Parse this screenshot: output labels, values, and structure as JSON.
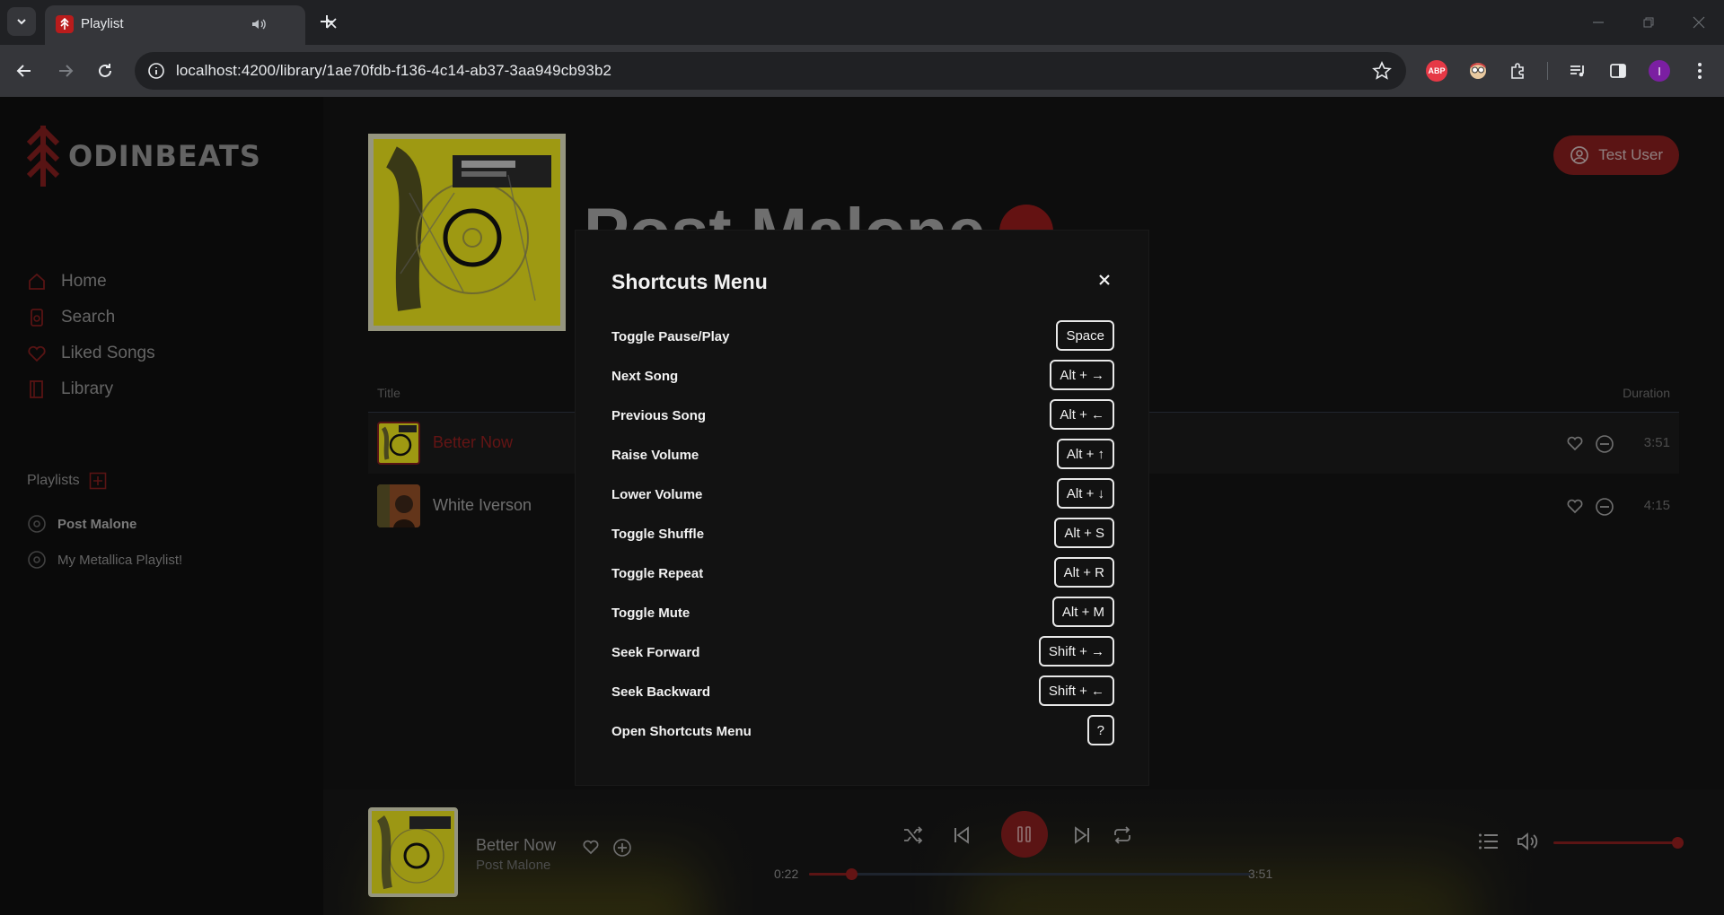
{
  "browser": {
    "tab_title": "Playlist",
    "url": "localhost:4200/library/1ae70fdb-f136-4c14-ab37-3aa949cb93b2",
    "profile_initial": "I",
    "abp_label": "ABP"
  },
  "app": {
    "logo_text": "ODINBEATS",
    "nav": [
      {
        "label": "Home",
        "icon": "home-icon"
      },
      {
        "label": "Search",
        "icon": "search-icon"
      },
      {
        "label": "Liked Songs",
        "icon": "heart-icon"
      },
      {
        "label": "Library",
        "icon": "library-icon"
      }
    ],
    "playlists_label": "Playlists",
    "playlists": [
      {
        "label": "Post Malone",
        "active": true
      },
      {
        "label": "My Metallica Playlist!",
        "active": false
      }
    ],
    "user_label": "Test User",
    "playlist_title": "Post Malone",
    "columns": {
      "title": "Title",
      "duration": "Duration"
    },
    "tracks": [
      {
        "title": "Better Now",
        "duration": "3:51",
        "playing": true
      },
      {
        "title": "White Iverson",
        "duration": "4:15",
        "playing": false
      }
    ]
  },
  "player": {
    "song": "Better Now",
    "artist": "Post Malone",
    "elapsed": "0:22",
    "total": "3:51",
    "progress": 0.095,
    "volume": 1.0
  },
  "shortcuts": {
    "title": "Shortcuts Menu",
    "items": [
      {
        "label": "Toggle Pause/Play",
        "key": "Space"
      },
      {
        "label": "Next Song",
        "key": "Alt + →"
      },
      {
        "label": "Previous Song",
        "key": "Alt + ←"
      },
      {
        "label": "Raise Volume",
        "key": "Alt + ↑"
      },
      {
        "label": "Lower Volume",
        "key": "Alt + ↓"
      },
      {
        "label": "Toggle Shuffle",
        "key": "Alt + S"
      },
      {
        "label": "Toggle Repeat",
        "key": "Alt + R"
      },
      {
        "label": "Toggle Mute",
        "key": "Alt + M"
      },
      {
        "label": "Seek Forward",
        "key": "Shift + →"
      },
      {
        "label": "Seek Backward",
        "key": "Shift + ←"
      },
      {
        "label": "Open Shortcuts Menu",
        "key": "?"
      }
    ]
  },
  "colors": {
    "accent": "#7f1d1d",
    "background": "#121212",
    "sidebar": "#0e0e0e"
  }
}
